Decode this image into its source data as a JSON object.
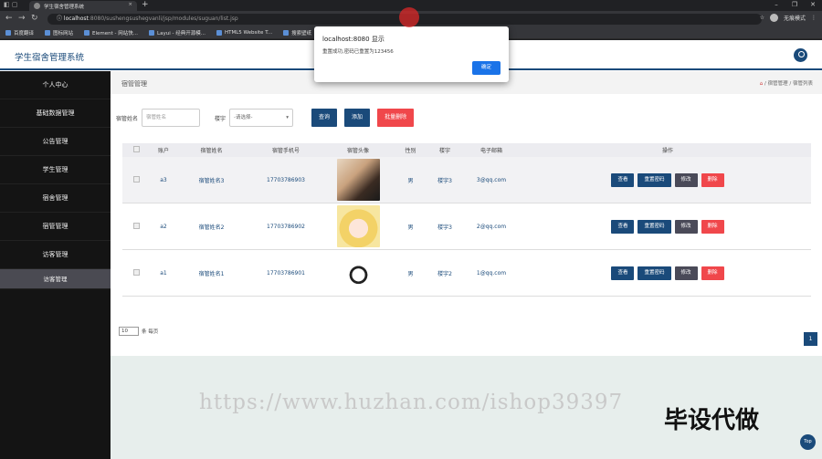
{
  "browser": {
    "tab_title": "学生宿舍管理系统",
    "url_host": "localhost",
    "url_path": ":8080/sushengsushegvanli/jsp/modules/suguan/list.jsp",
    "profile_label": "无痕模式",
    "bookmarks": [
      "百度翻译",
      "图标网站",
      "Element - 网站快...",
      "Layui - 经典开源模...",
      "HTML5 Website T...",
      "搜索壁纸"
    ]
  },
  "app": {
    "title": "学生宿舍管理系统"
  },
  "sidebar": {
    "items": [
      {
        "label": "个人中心"
      },
      {
        "label": "基础数据管理"
      },
      {
        "label": "公告管理"
      },
      {
        "label": "学生管理"
      },
      {
        "label": "宿舍管理"
      },
      {
        "label": "宿管管理"
      },
      {
        "label": "访客管理"
      }
    ],
    "active_sub": "访客管理"
  },
  "page": {
    "title": "宿管管理",
    "breadcrumb": [
      "宿管管理",
      "宿管列表"
    ]
  },
  "search": {
    "name_label": "宿管姓名",
    "name_placeholder": "宿管姓名",
    "building_label": "楼宇",
    "building_value": "-请选择-",
    "query_btn": "查询",
    "add_btn": "添加",
    "batch_delete_btn": "批量删除"
  },
  "table": {
    "headers": [
      "账户",
      "宿管姓名",
      "宿管手机号",
      "宿管头像",
      "性别",
      "楼宇",
      "电子邮箱",
      "操作"
    ],
    "rows": [
      {
        "account": "a3",
        "name": "宿管姓名3",
        "phone": "17703786903",
        "gender": "男",
        "building": "楼宇3",
        "email": "3@qq.com"
      },
      {
        "account": "a2",
        "name": "宿管姓名2",
        "phone": "17703786902",
        "gender": "男",
        "building": "楼宇3",
        "email": "2@qq.com"
      },
      {
        "account": "a1",
        "name": "宿管姓名1",
        "phone": "17703786901",
        "gender": "男",
        "building": "楼宇2",
        "email": "1@qq.com"
      }
    ],
    "ops": {
      "view": "查看",
      "reset_pwd": "重置密码",
      "edit": "修改",
      "delete": "删除"
    }
  },
  "pager": {
    "page_size": "10",
    "per_page_label": "条 每页",
    "current_page": "1"
  },
  "top_button": "Top",
  "dialog": {
    "title": "localhost:8080 显示",
    "message": "重置成功,密码已重置为123456",
    "ok": "确定"
  },
  "overlay": {
    "watermark": "https://www.huzhan.com/ishop39397",
    "promo": "毕设代做"
  }
}
